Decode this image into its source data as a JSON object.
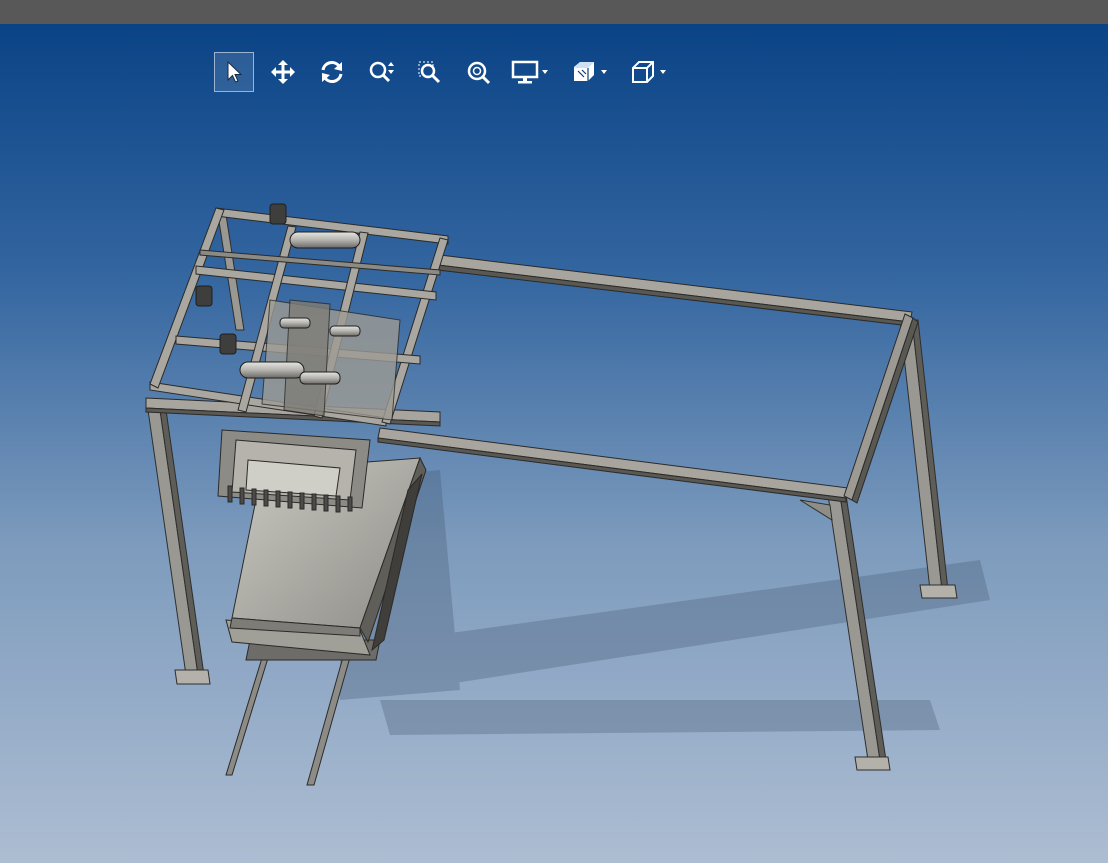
{
  "colors": {
    "titlebar": "#585858",
    "viewport_top": "#0a4386",
    "viewport_bottom": "#adbdd2",
    "steel": "#a7a59e",
    "steel_dark": "#56544f",
    "tool_icon": "#ffffff"
  },
  "toolbar": {
    "tools": [
      {
        "name": "select",
        "icon": "pointer-arrow-icon",
        "active": true
      },
      {
        "name": "pan",
        "icon": "four-way-arrows-icon",
        "active": false
      },
      {
        "name": "rotate",
        "icon": "rotate-arrows-icon",
        "active": false
      },
      {
        "name": "zoom",
        "icon": "zoom-up-down-icon",
        "active": false
      },
      {
        "name": "zoom-window",
        "icon": "zoom-window-icon",
        "active": false
      },
      {
        "name": "zoom-fit",
        "icon": "zoom-fit-icon",
        "active": false
      },
      {
        "name": "display-mode",
        "icon": "monitor-icon",
        "has_dropdown": true
      },
      {
        "name": "section-view",
        "icon": "section-box-icon",
        "has_dropdown": true
      },
      {
        "name": "view-orientation",
        "icon": "cube-icon",
        "has_dropdown": true
      }
    ]
  },
  "model": {
    "description_icon": "gantry-frame-3d-model"
  }
}
